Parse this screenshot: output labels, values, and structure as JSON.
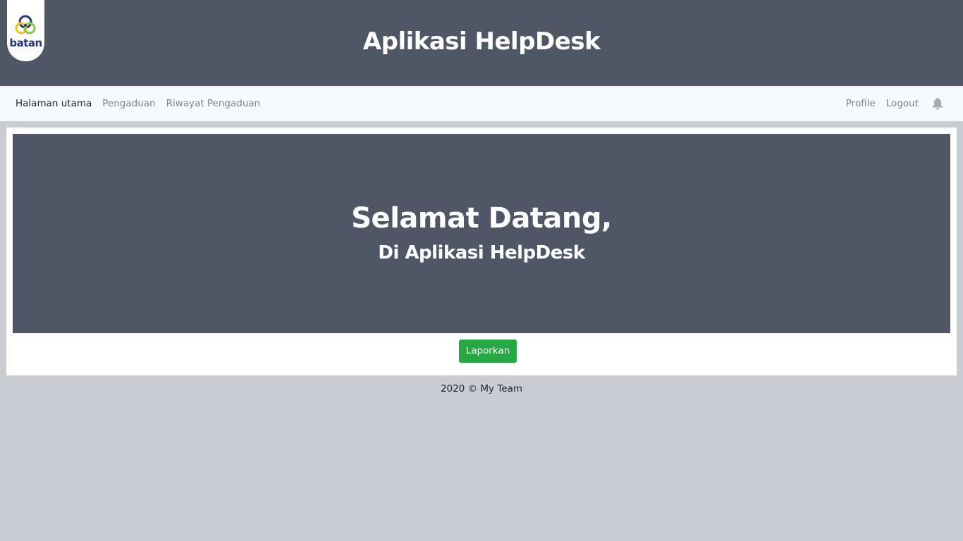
{
  "header": {
    "logo_text": "batan",
    "title": "Aplikasi HelpDesk"
  },
  "navbar": {
    "left_links": [
      {
        "label": "Halaman utama",
        "active": true
      },
      {
        "label": "Pengaduan",
        "active": false
      },
      {
        "label": "Riwayat Pengaduan",
        "active": false
      }
    ],
    "right_links": [
      {
        "label": "Profile"
      },
      {
        "label": "Logout"
      }
    ],
    "notification_icon": "bell-icon"
  },
  "main": {
    "welcome_title": "Selamat Datang,",
    "welcome_subtitle": "Di Aplikasi HelpDesk",
    "report_button_label": "Laporkan"
  },
  "footer": {
    "text": "2020 © My Team"
  },
  "colors": {
    "header_bg": "#4f5766",
    "page_bg": "#caccd1",
    "navbar_bg": "#f8f9fa",
    "button_green": "#28a745",
    "logo_blue": "#27357a",
    "logo_yellow": "#f2c01d",
    "logo_green": "#8cc63f"
  }
}
